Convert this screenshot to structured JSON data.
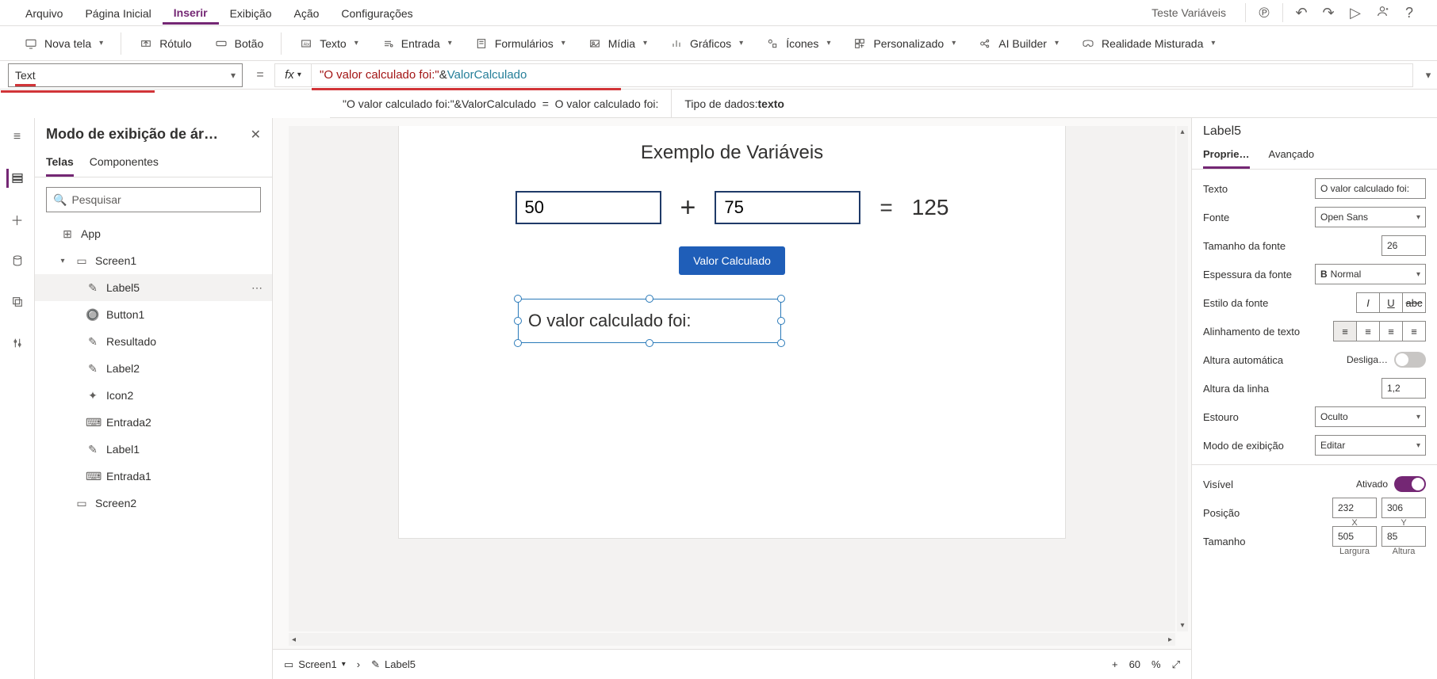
{
  "menubar": {
    "items": [
      "Arquivo",
      "Página Inicial",
      "Inserir",
      "Exibição",
      "Ação",
      "Configurações"
    ],
    "active_index": 2,
    "app_title": "Teste Variáveis"
  },
  "ribbon": {
    "new_screen": "Nova tela",
    "label": "Rótulo",
    "button": "Botão",
    "text": "Texto",
    "input": "Entrada",
    "forms": "Formulários",
    "media": "Mídia",
    "charts": "Gráficos",
    "icons": "Ícones",
    "custom": "Personalizado",
    "ai_builder": "AI Builder",
    "mixed_reality": "Realidade Misturada"
  },
  "formula": {
    "property": "Text",
    "string_part": "\"O valor calculado foi:\"",
    "operator": "&",
    "variable": "ValorCalculado",
    "eval_left": "\"O valor calculado foi:\"&ValorCalculado",
    "eval_right": "O valor calculado foi:",
    "data_type_label": "Tipo de dados: ",
    "data_type_value": "texto",
    "eq": "="
  },
  "tree": {
    "title": "Modo de exibição de ár…",
    "tabs": [
      "Telas",
      "Componentes"
    ],
    "active_tab": 0,
    "search_placeholder": "Pesquisar",
    "app_root": "App",
    "items": [
      {
        "name": "Screen1",
        "kind": "screen",
        "expanded": true
      },
      {
        "name": "Label5",
        "kind": "label",
        "selected": true
      },
      {
        "name": "Button1",
        "kind": "button"
      },
      {
        "name": "Resultado",
        "kind": "label"
      },
      {
        "name": "Label2",
        "kind": "label"
      },
      {
        "name": "Icon2",
        "kind": "icon"
      },
      {
        "name": "Entrada2",
        "kind": "input"
      },
      {
        "name": "Label1",
        "kind": "label"
      },
      {
        "name": "Entrada1",
        "kind": "input"
      },
      {
        "name": "Screen2",
        "kind": "screen"
      }
    ]
  },
  "canvas": {
    "heading": "Exemplo de Variáveis",
    "value1": "50",
    "value2": "75",
    "result": "125",
    "plus": "+",
    "equals": "=",
    "calc_button": "Valor Calculado",
    "selected_label_text": "O valor calculado foi:"
  },
  "status": {
    "screen": "Screen1",
    "control": "Label5",
    "zoom_plus": "+",
    "zoom_pct": "60",
    "zoom_pct_sign": "%"
  },
  "props": {
    "selected": "Label5",
    "tabs": [
      "Proprie…",
      "Avançado"
    ],
    "active_tab": 0,
    "text_label": "Texto",
    "text_value": "O valor calculado foi:",
    "font_label": "Fonte",
    "font_value": "Open Sans",
    "font_size_label": "Tamanho da fonte",
    "font_size_value": "26",
    "font_weight_label": "Espessura da fonte",
    "font_weight_value": "Normal",
    "font_style_label": "Estilo da fonte",
    "align_label": "Alinhamento de texto",
    "auto_height_label": "Altura automática",
    "auto_height_value": "Desliga…",
    "line_height_label": "Altura da linha",
    "line_height_value": "1,2",
    "overflow_label": "Estouro",
    "overflow_value": "Oculto",
    "display_mode_label": "Modo de exibição",
    "display_mode_value": "Editar",
    "visible_label": "Visível",
    "visible_value": "Ativado",
    "position_label": "Posição",
    "pos_x": "232",
    "pos_y": "306",
    "x_label": "X",
    "y_label": "Y",
    "size_label": "Tamanho",
    "width": "505",
    "height": "85",
    "width_label": "Largura",
    "height_label": "Altura"
  }
}
